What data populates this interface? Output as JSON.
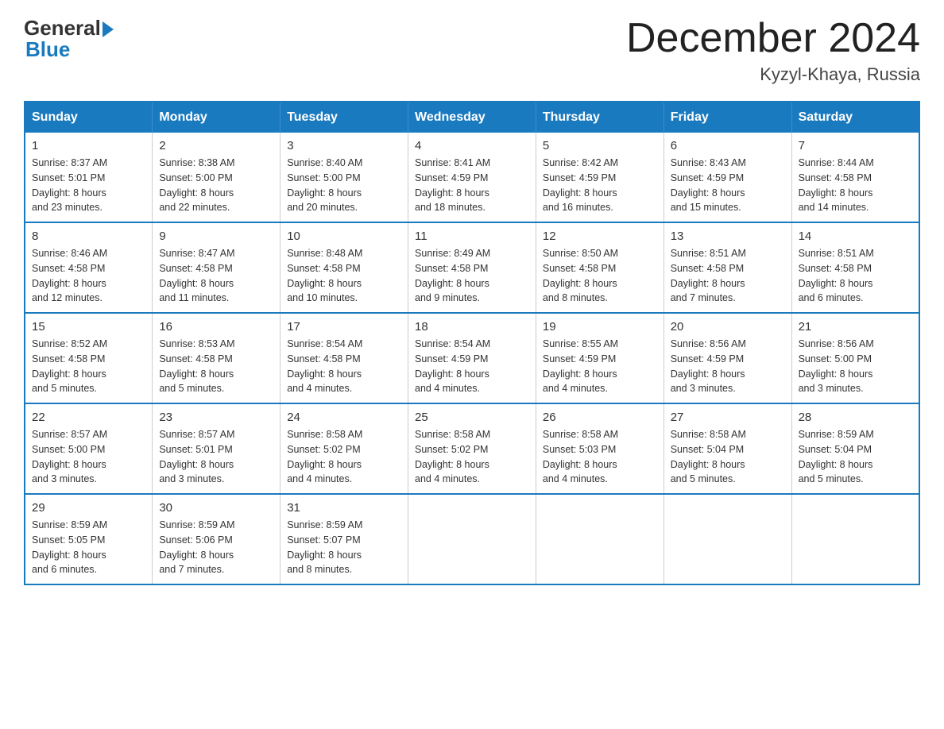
{
  "header": {
    "logo_general": "General",
    "logo_blue": "Blue",
    "month_title": "December 2024",
    "location": "Kyzyl-Khaya, Russia"
  },
  "calendar": {
    "days_of_week": [
      "Sunday",
      "Monday",
      "Tuesday",
      "Wednesday",
      "Thursday",
      "Friday",
      "Saturday"
    ],
    "weeks": [
      [
        {
          "day": "1",
          "info": "Sunrise: 8:37 AM\nSunset: 5:01 PM\nDaylight: 8 hours\nand 23 minutes."
        },
        {
          "day": "2",
          "info": "Sunrise: 8:38 AM\nSunset: 5:00 PM\nDaylight: 8 hours\nand 22 minutes."
        },
        {
          "day": "3",
          "info": "Sunrise: 8:40 AM\nSunset: 5:00 PM\nDaylight: 8 hours\nand 20 minutes."
        },
        {
          "day": "4",
          "info": "Sunrise: 8:41 AM\nSunset: 4:59 PM\nDaylight: 8 hours\nand 18 minutes."
        },
        {
          "day": "5",
          "info": "Sunrise: 8:42 AM\nSunset: 4:59 PM\nDaylight: 8 hours\nand 16 minutes."
        },
        {
          "day": "6",
          "info": "Sunrise: 8:43 AM\nSunset: 4:59 PM\nDaylight: 8 hours\nand 15 minutes."
        },
        {
          "day": "7",
          "info": "Sunrise: 8:44 AM\nSunset: 4:58 PM\nDaylight: 8 hours\nand 14 minutes."
        }
      ],
      [
        {
          "day": "8",
          "info": "Sunrise: 8:46 AM\nSunset: 4:58 PM\nDaylight: 8 hours\nand 12 minutes."
        },
        {
          "day": "9",
          "info": "Sunrise: 8:47 AM\nSunset: 4:58 PM\nDaylight: 8 hours\nand 11 minutes."
        },
        {
          "day": "10",
          "info": "Sunrise: 8:48 AM\nSunset: 4:58 PM\nDaylight: 8 hours\nand 10 minutes."
        },
        {
          "day": "11",
          "info": "Sunrise: 8:49 AM\nSunset: 4:58 PM\nDaylight: 8 hours\nand 9 minutes."
        },
        {
          "day": "12",
          "info": "Sunrise: 8:50 AM\nSunset: 4:58 PM\nDaylight: 8 hours\nand 8 minutes."
        },
        {
          "day": "13",
          "info": "Sunrise: 8:51 AM\nSunset: 4:58 PM\nDaylight: 8 hours\nand 7 minutes."
        },
        {
          "day": "14",
          "info": "Sunrise: 8:51 AM\nSunset: 4:58 PM\nDaylight: 8 hours\nand 6 minutes."
        }
      ],
      [
        {
          "day": "15",
          "info": "Sunrise: 8:52 AM\nSunset: 4:58 PM\nDaylight: 8 hours\nand 5 minutes."
        },
        {
          "day": "16",
          "info": "Sunrise: 8:53 AM\nSunset: 4:58 PM\nDaylight: 8 hours\nand 5 minutes."
        },
        {
          "day": "17",
          "info": "Sunrise: 8:54 AM\nSunset: 4:58 PM\nDaylight: 8 hours\nand 4 minutes."
        },
        {
          "day": "18",
          "info": "Sunrise: 8:54 AM\nSunset: 4:59 PM\nDaylight: 8 hours\nand 4 minutes."
        },
        {
          "day": "19",
          "info": "Sunrise: 8:55 AM\nSunset: 4:59 PM\nDaylight: 8 hours\nand 4 minutes."
        },
        {
          "day": "20",
          "info": "Sunrise: 8:56 AM\nSunset: 4:59 PM\nDaylight: 8 hours\nand 3 minutes."
        },
        {
          "day": "21",
          "info": "Sunrise: 8:56 AM\nSunset: 5:00 PM\nDaylight: 8 hours\nand 3 minutes."
        }
      ],
      [
        {
          "day": "22",
          "info": "Sunrise: 8:57 AM\nSunset: 5:00 PM\nDaylight: 8 hours\nand 3 minutes."
        },
        {
          "day": "23",
          "info": "Sunrise: 8:57 AM\nSunset: 5:01 PM\nDaylight: 8 hours\nand 3 minutes."
        },
        {
          "day": "24",
          "info": "Sunrise: 8:58 AM\nSunset: 5:02 PM\nDaylight: 8 hours\nand 4 minutes."
        },
        {
          "day": "25",
          "info": "Sunrise: 8:58 AM\nSunset: 5:02 PM\nDaylight: 8 hours\nand 4 minutes."
        },
        {
          "day": "26",
          "info": "Sunrise: 8:58 AM\nSunset: 5:03 PM\nDaylight: 8 hours\nand 4 minutes."
        },
        {
          "day": "27",
          "info": "Sunrise: 8:58 AM\nSunset: 5:04 PM\nDaylight: 8 hours\nand 5 minutes."
        },
        {
          "day": "28",
          "info": "Sunrise: 8:59 AM\nSunset: 5:04 PM\nDaylight: 8 hours\nand 5 minutes."
        }
      ],
      [
        {
          "day": "29",
          "info": "Sunrise: 8:59 AM\nSunset: 5:05 PM\nDaylight: 8 hours\nand 6 minutes."
        },
        {
          "day": "30",
          "info": "Sunrise: 8:59 AM\nSunset: 5:06 PM\nDaylight: 8 hours\nand 7 minutes."
        },
        {
          "day": "31",
          "info": "Sunrise: 8:59 AM\nSunset: 5:07 PM\nDaylight: 8 hours\nand 8 minutes."
        },
        {
          "day": "",
          "info": ""
        },
        {
          "day": "",
          "info": ""
        },
        {
          "day": "",
          "info": ""
        },
        {
          "day": "",
          "info": ""
        }
      ]
    ]
  }
}
